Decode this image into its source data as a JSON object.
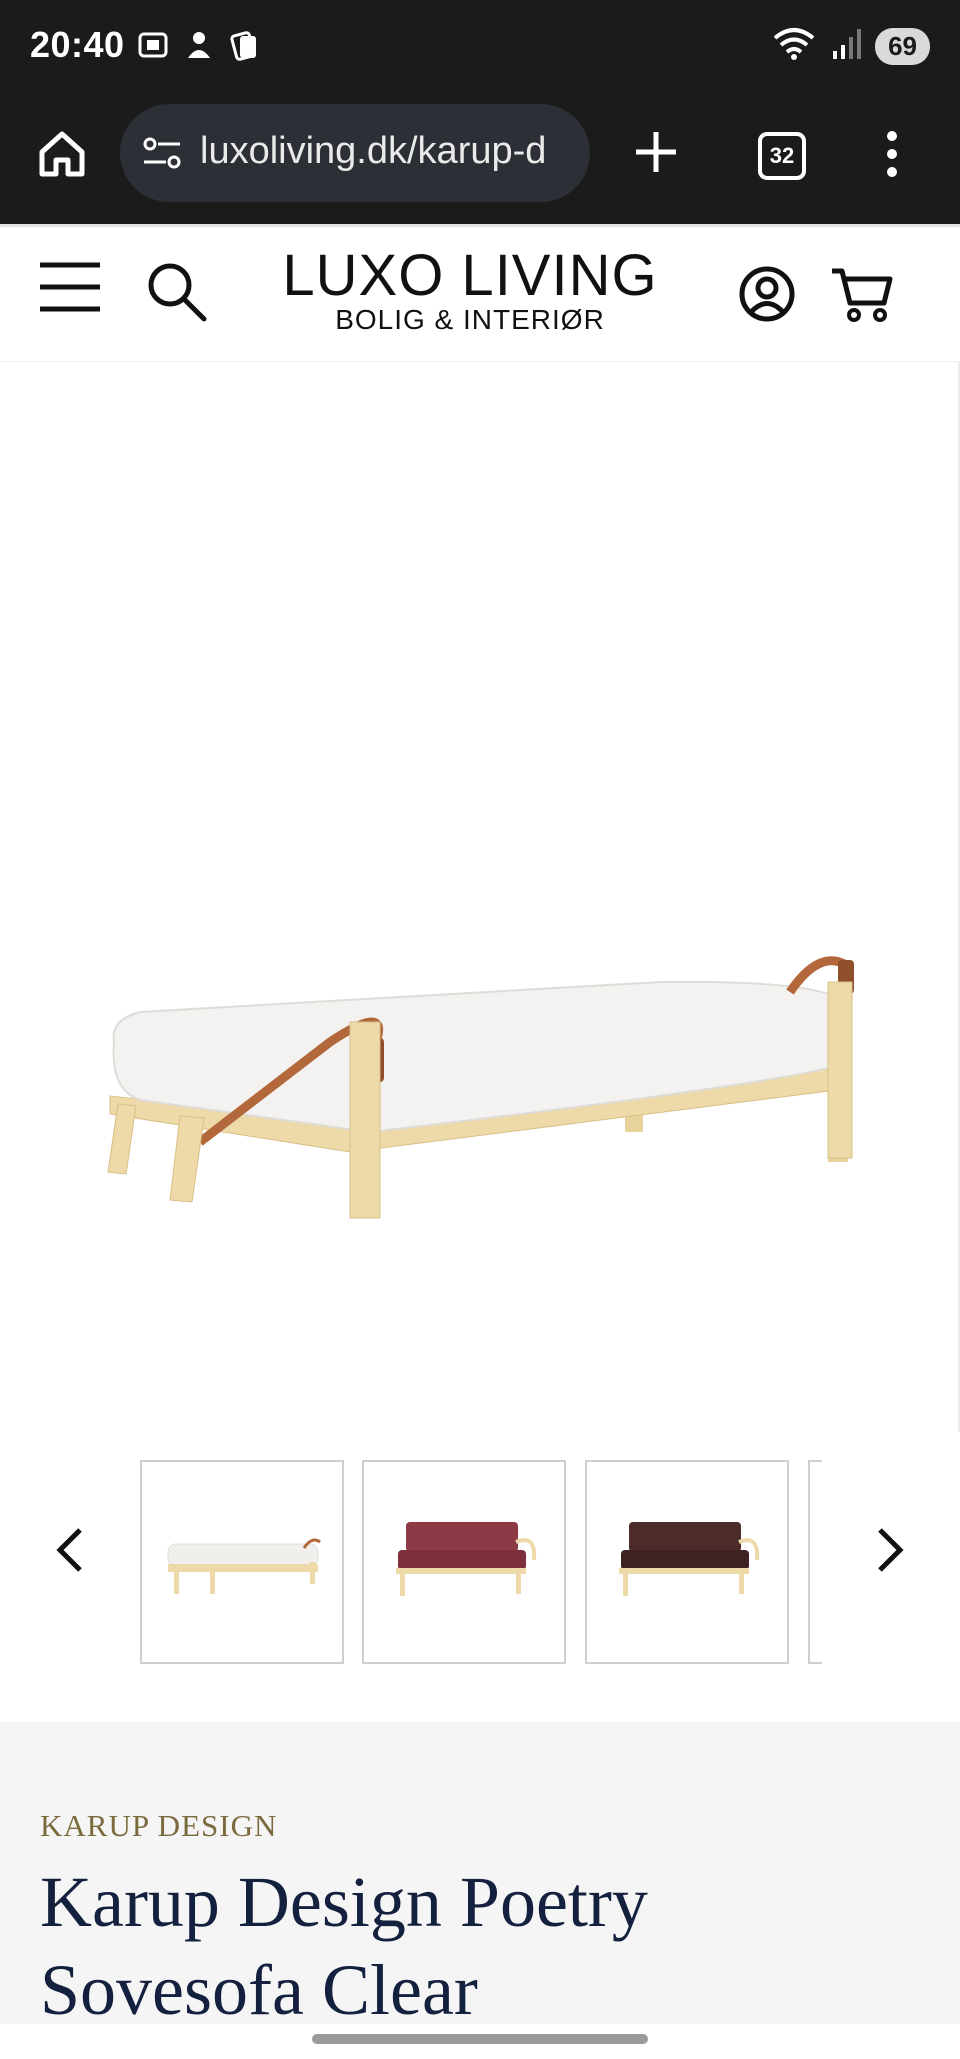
{
  "status_bar": {
    "time": "20:40",
    "battery": "69",
    "wifi_label": "5"
  },
  "browser": {
    "url": "luxoliving.dk/karup-d",
    "tab_count": "32"
  },
  "header": {
    "logo_line1": "LUXO LIVING",
    "logo_line2": "BOLIG & INTERIØR"
  },
  "product": {
    "brand": "KARUP DESIGN",
    "title": "Karup Design Poetry Sovesofa Clear"
  },
  "thumbnails": [
    {
      "name": "natural-mattress",
      "color": "#f1efec"
    },
    {
      "name": "bordeaux",
      "color": "#8c3a45"
    },
    {
      "name": "brown",
      "color": "#4c2b2b"
    }
  ],
  "colors": {
    "wood": "#eed9a8",
    "strap": "#b2683a",
    "mattress": "#f3f2f0"
  }
}
